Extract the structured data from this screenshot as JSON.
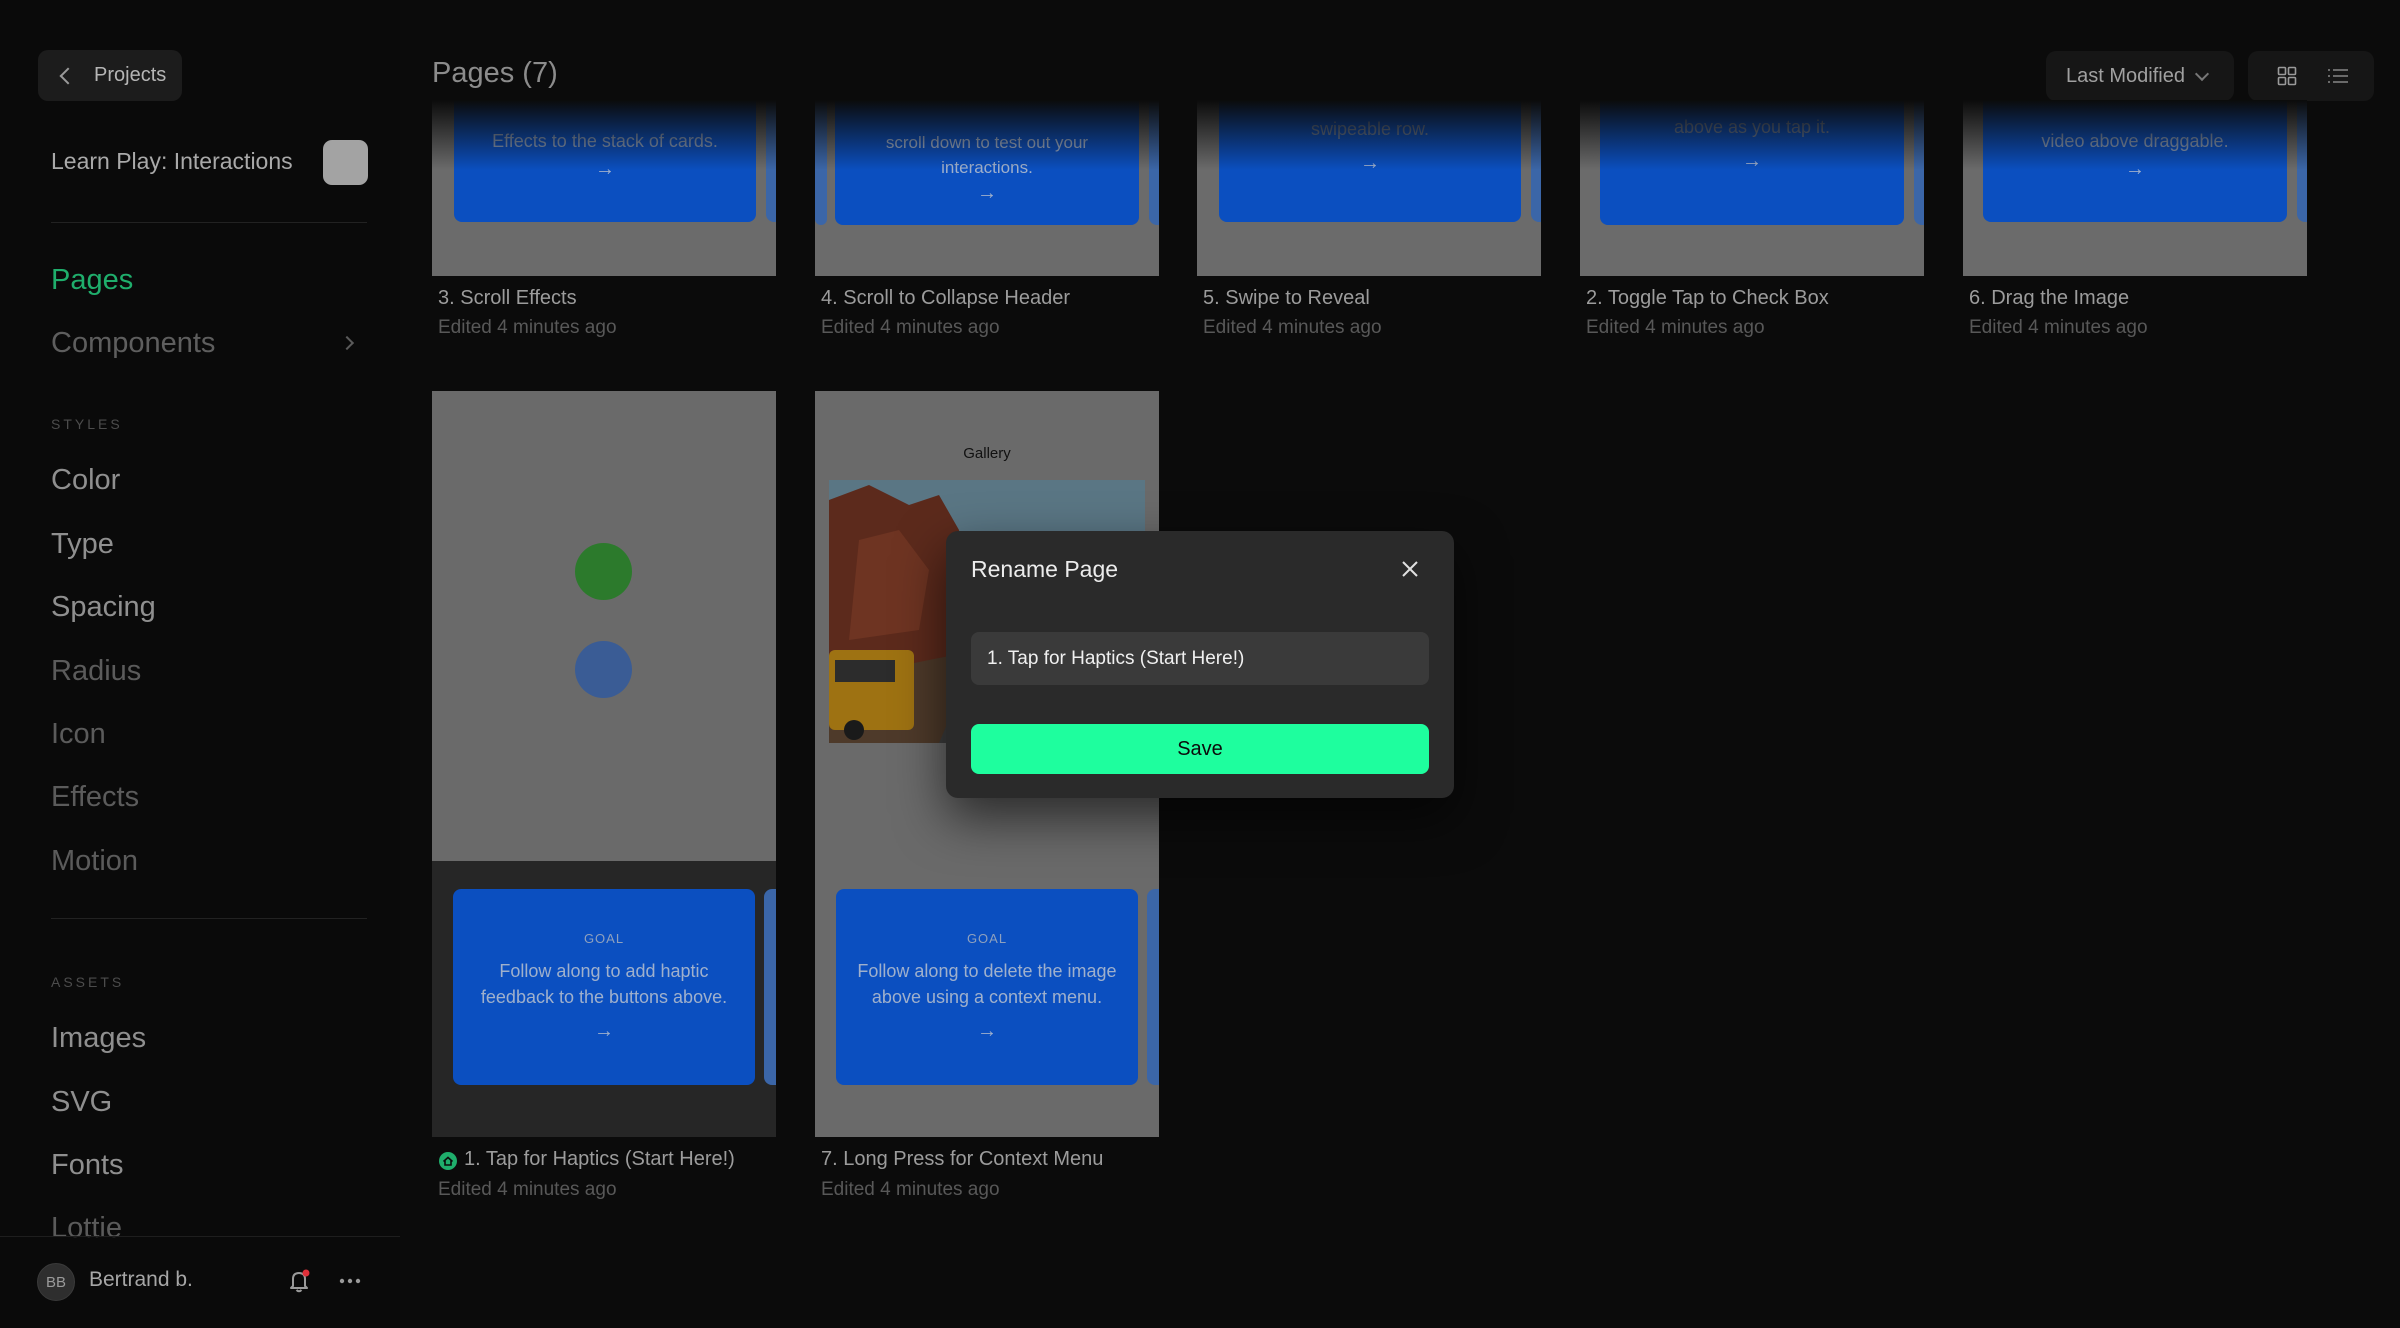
{
  "sidebar": {
    "back_label": "Projects",
    "project_name": "Learn Play: Interactions",
    "nav": {
      "pages": "Pages",
      "components": "Components"
    },
    "styles_label": "STYLES",
    "styles": [
      "Color",
      "Type",
      "Spacing",
      "Radius",
      "Icon",
      "Effects",
      "Motion"
    ],
    "assets_label": "ASSETS",
    "assets": [
      "Images",
      "SVG",
      "Fonts",
      "Lottie"
    ],
    "user": {
      "initials": "BB",
      "name": "Bertrand b."
    }
  },
  "header": {
    "title": "Pages (7)",
    "sort_label": "Last Modified"
  },
  "pages": [
    {
      "title": "3. Scroll Effects",
      "subtitle": "Edited 4 minutes ago",
      "goal_text": "Effects to the stack of cards."
    },
    {
      "title": "4. Scroll to Collapse Header",
      "subtitle": "Edited 4 minutes ago",
      "goal_text": "scroll down to test out your interactions."
    },
    {
      "title": "5. Swipe to Reveal",
      "subtitle": "Edited 4 minutes ago",
      "goal_text": "swipeable row."
    },
    {
      "title": "2. Toggle Tap to Check Box",
      "subtitle": "Edited 4 minutes ago",
      "goal_text": "above as you tap it."
    },
    {
      "title": "6. Drag the Image",
      "subtitle": "Edited 4 minutes ago",
      "goal_text": "video above draggable."
    },
    {
      "title": "1. Tap for Haptics (Start Here!)",
      "subtitle": "Edited 4 minutes ago",
      "goal_label": "GOAL",
      "goal_text": "Follow along to add haptic feedback to the buttons above."
    },
    {
      "title": "7. Long Press for Context Menu",
      "subtitle": "Edited 4 minutes ago",
      "goal_label": "GOAL",
      "goal_text": "Follow along to delete the image above using a context menu.",
      "gallery_label": "Gallery"
    }
  ],
  "modal": {
    "title": "Rename Page",
    "input_value": "1. Tap for Haptics (Start Here!)",
    "save_label": "Save"
  },
  "colors": {
    "accent": "#1efe9e",
    "active_nav": "#1fae6c",
    "goal_card": "#0b4fc0"
  },
  "icons": [
    "chevron-left-icon",
    "chevron-right-icon",
    "chevron-down-icon",
    "grid-view-icon",
    "list-view-icon",
    "close-icon",
    "bell-icon",
    "more-icon",
    "arrow-right-icon",
    "home-icon"
  ]
}
